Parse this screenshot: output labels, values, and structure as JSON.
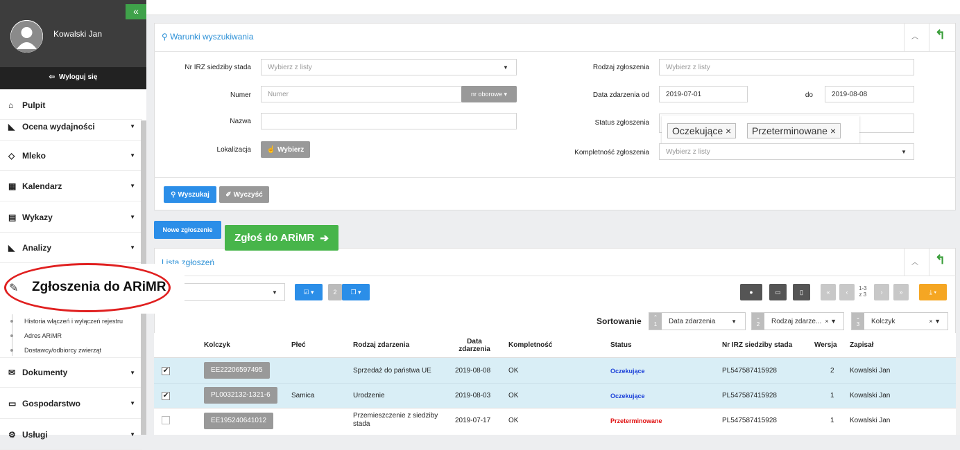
{
  "sidebar": {
    "collapse_label": "«",
    "user_name": "Kowalski Jan",
    "logout_label": "Wyloguj się",
    "items": [
      {
        "label": "Pulpit",
        "icon": "home-icon"
      },
      {
        "label": "Ocena wydajności",
        "icon": "area-chart-icon"
      },
      {
        "label": "Mleko",
        "icon": "drop-icon"
      },
      {
        "label": "Kalendarz",
        "icon": "calendar-icon"
      },
      {
        "label": "Wykazy",
        "icon": "list-icon"
      },
      {
        "label": "Analizy",
        "icon": "area-chart-icon"
      },
      {
        "label": "Dokumenty",
        "icon": "envelope-icon"
      },
      {
        "label": "Gospodarstwo",
        "icon": "monitor-icon"
      },
      {
        "label": "Usługi",
        "icon": "gears-icon"
      }
    ],
    "highlight": {
      "label": "Zgłoszenia do ARiMR",
      "icon": "paperclip-icon"
    },
    "subitems": [
      "Historia włączeń i wyłączeń rejestru",
      "Adres ARiMR",
      "Dostawcy/odbiorcy zwierząt"
    ]
  },
  "search": {
    "title": "Warunki wyszukiwania",
    "nr_irz_label": "Nr IRZ siedziby stada",
    "nr_irz_placeholder": "Wybierz z listy",
    "numer_label": "Numer",
    "numer_placeholder": "Numer",
    "numer_btn": "nr oborowe ▾",
    "nazwa_label": "Nazwa",
    "lokalizacja_label": "Lokalizacja",
    "wybierz_btn": "Wybierz",
    "rodzaj_label": "Rodzaj zgłoszenia",
    "rodzaj_placeholder": "Wybierz z listy",
    "data_od_label": "Data zdarzenia od",
    "data_od_value": "2019-07-01",
    "do_label": "do",
    "data_do_value": "2019-08-08",
    "status_label": "Status zgłoszenia",
    "status_tags": [
      "Oczekujące ×",
      "Przeterminowane ×"
    ],
    "kompletnosc_label": "Kompletność zgłoszenia",
    "kompletnosc_placeholder": "Wybierz z listy",
    "search_btn": "Wyszukaj",
    "clear_btn": "Wyczyść"
  },
  "actions": {
    "new_btn": "Nowe zgłoszenie",
    "arimr_btn": "Zgłoś do ARiMR"
  },
  "list": {
    "title": "Lista zgłoszeń",
    "selected_count": "2",
    "pagination": "1-3",
    "pagination_total": "z 3",
    "sort_label": "Sortowanie",
    "sorts": [
      {
        "num": "1",
        "label": "Data zdarzenia"
      },
      {
        "num": "2",
        "label": "Rodzaj zdarze..."
      },
      {
        "num": "3",
        "label": "Kolczyk"
      }
    ],
    "columns": [
      "Kolczyk",
      "Płeć",
      "Rodzaj zdarzenia",
      "Data zdarzenia",
      "Kompletność",
      "Status",
      "Nr IRZ siedziby stada",
      "Wersja",
      "Zapisał"
    ],
    "rows": [
      {
        "checked": "✔",
        "kolczyk": "EE22206597495",
        "plec": "",
        "rodzaj": "Sprzedaż do państwa UE",
        "data": "2019-08-08",
        "kompletnosc": "OK",
        "status": "Oczekujące",
        "status_color": "#1a3fd8",
        "nr_irz": "PL547587415928",
        "wersja": "2",
        "zapisal": "Kowalski Jan"
      },
      {
        "checked": "✔",
        "kolczyk": "PL0032132-1321-6",
        "plec": "Samica",
        "rodzaj": "Urodzenie",
        "data": "2019-08-03",
        "kompletnosc": "OK",
        "status": "Oczekujące",
        "status_color": "#1a3fd8",
        "nr_irz": "PL547587415928",
        "wersja": "1",
        "zapisal": "Kowalski Jan"
      },
      {
        "checked": "",
        "kolczyk": "EE195240641012",
        "plec": "",
        "rodzaj": "Przemieszczenie z siedziby stada",
        "data": "2019-07-17",
        "kompletnosc": "OK",
        "status": "Przeterminowane",
        "status_color": "#e01010",
        "nr_irz": "PL547587415928",
        "wersja": "1",
        "zapisal": "Kowalski Jan"
      }
    ]
  }
}
